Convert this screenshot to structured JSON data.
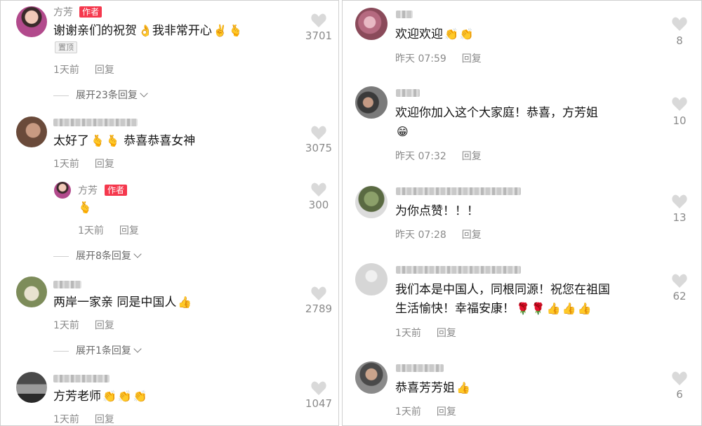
{
  "left": {
    "c1": {
      "name": "方芳",
      "badge": "作者",
      "text": "谢谢亲们的祝贺",
      "text2": "我非常开心",
      "pin": "置顶",
      "time": "1天前",
      "reply": "回复",
      "likes": "3701",
      "expand": "展开23条回复"
    },
    "c2": {
      "text": "太好了",
      "text2": "恭喜恭喜女神",
      "time": "1天前",
      "reply": "回复",
      "likes": "3075"
    },
    "c2r": {
      "name": "方芳",
      "badge": "作者",
      "time": "1天前",
      "reply": "回复",
      "likes": "300",
      "expand": "展开8条回复"
    },
    "c3": {
      "text": "两岸一家亲 同是中国人",
      "time": "1天前",
      "reply": "回复",
      "likes": "2789",
      "expand": "展开1条回复"
    },
    "c4": {
      "text": "方芳老师",
      "time": "1天前",
      "reply": "回复",
      "likes": "1047"
    }
  },
  "right": {
    "c1": {
      "text": "欢迎欢迎",
      "time": "昨天 07:59",
      "reply": "回复",
      "likes": "8"
    },
    "c2": {
      "text": "欢迎你加入这个大家庭！恭喜，方芳姐",
      "time": "昨天 07:32",
      "reply": "回复",
      "likes": "10"
    },
    "c3": {
      "text": "为你点赞！！！",
      "time": "昨天 07:28",
      "reply": "回复",
      "likes": "13"
    },
    "c4": {
      "text": "我们本是中国人，同根同源！祝您在祖国",
      "text2": "生活愉快！幸福安康！",
      "time": "1天前",
      "reply": "回复",
      "likes": "62"
    },
    "c5": {
      "text": "恭喜芳芳姐",
      "time": "1天前",
      "reply": "回复",
      "likes": "6"
    }
  },
  "icons": {
    "heart": "heart-icon",
    "ok_hand": "ok-hand-emoji",
    "victory": "victory-hand-emoji",
    "finger_heart": "finger-heart-emoji",
    "clap": "clapping-hands-emoji",
    "grin": "grinning-face-emoji",
    "thumbs_up": "thumbs-up-emoji",
    "rose": "rose-emoji"
  },
  "colors": {
    "author_badge": "#f5384d",
    "text": "#141414",
    "meta": "#8a8a8a"
  }
}
